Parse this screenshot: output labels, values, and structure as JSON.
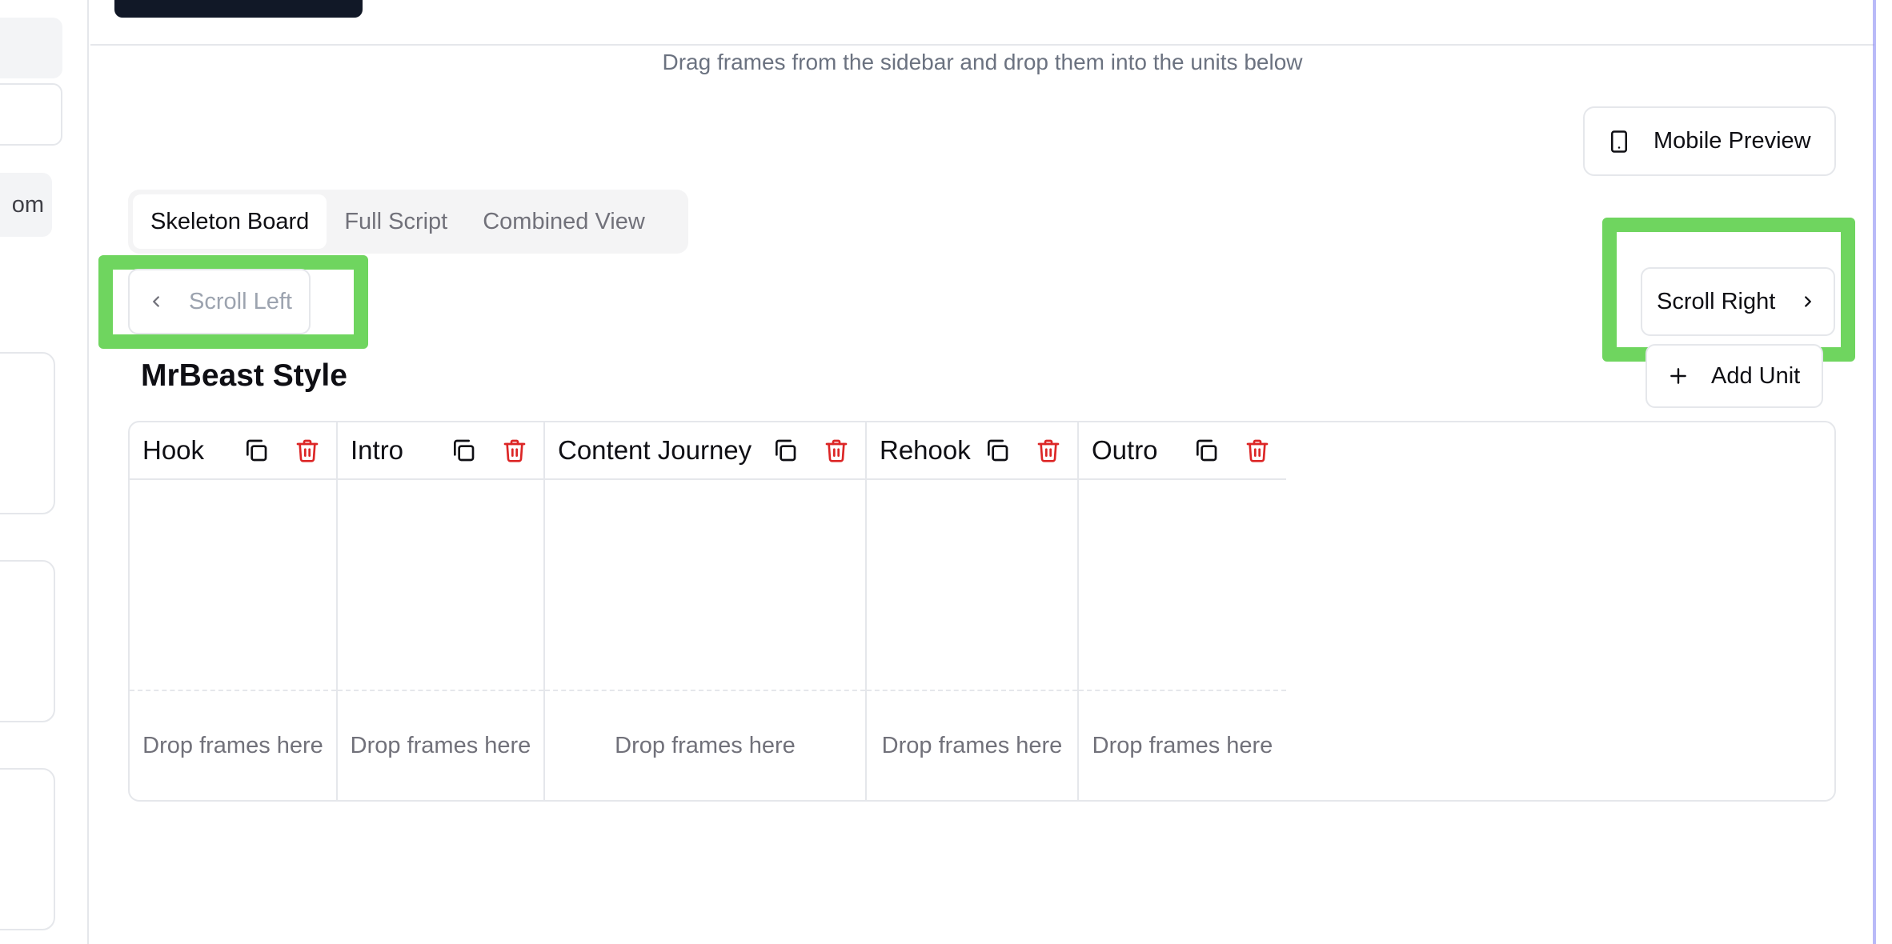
{
  "sidebar": {
    "chip_label": "om"
  },
  "main": {
    "instructions": "Drag frames from the sidebar and drop them into the units below",
    "mobile_preview_label": "Mobile Preview",
    "tabs": [
      {
        "label": "Skeleton Board",
        "active": true
      },
      {
        "label": "Full Script",
        "active": false
      },
      {
        "label": "Combined View",
        "active": false
      }
    ],
    "scroll_left_label": "Scroll Left",
    "scroll_right_label": "Scroll Right",
    "board_title": "MrBeast Style",
    "add_unit_label": "Add Unit",
    "units": [
      {
        "name": "Hook",
        "drop_text": "Drop frames here"
      },
      {
        "name": "Intro",
        "drop_text": "Drop frames here"
      },
      {
        "name": "Content Journey",
        "drop_text": "Drop frames here"
      },
      {
        "name": "Rehook",
        "drop_text": "Drop frames here"
      },
      {
        "name": "Outro",
        "drop_text": "Drop frames here"
      }
    ]
  },
  "colors": {
    "highlight": "#6fd55f",
    "delete": "#dc2626",
    "dark_button": "#111827"
  },
  "icons": {
    "mobile": "smartphone-icon",
    "scroll_left": "chevron-left-icon",
    "scroll_right": "chevron-right-icon",
    "add_unit": "plus-icon",
    "duplicate": "copy-icon",
    "delete": "trash-icon"
  }
}
